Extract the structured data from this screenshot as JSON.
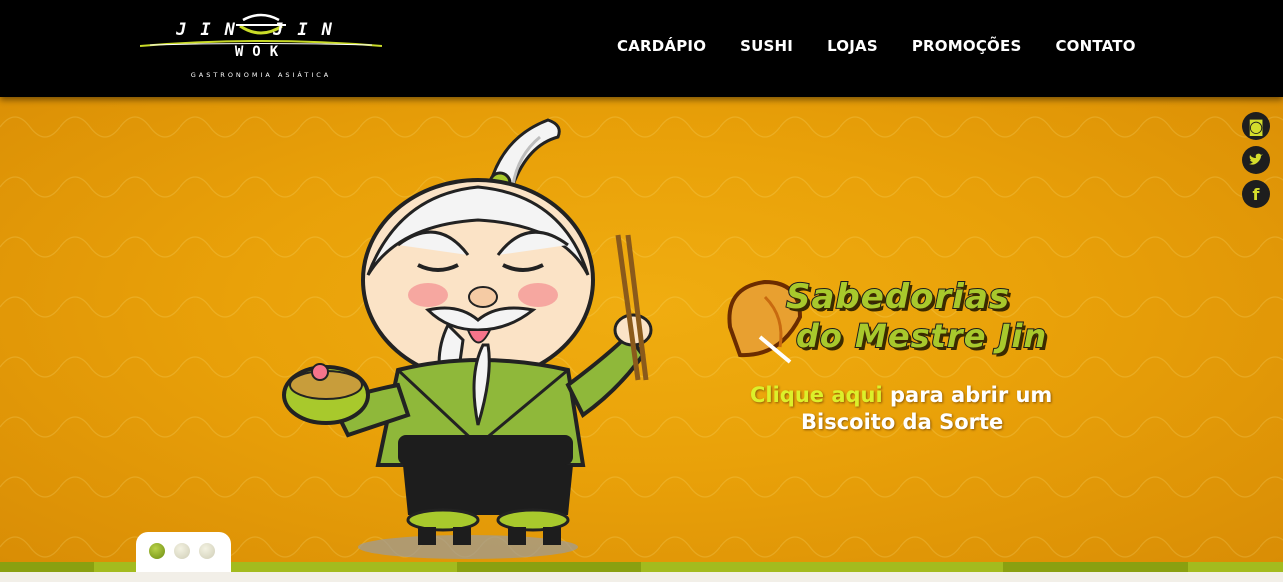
{
  "header": {
    "logo": {
      "brand": "JIN JIN",
      "sub": "WOK",
      "tagline": "GASTRONOMIA ASIÁTICA"
    },
    "nav": [
      {
        "label": "CARDÁPIO"
      },
      {
        "label": "SUSHI"
      },
      {
        "label": "LOJAS"
      },
      {
        "label": "PROMOÇÕES"
      },
      {
        "label": "CONTATO"
      }
    ]
  },
  "banner": {
    "title_line1": "Sabedorias",
    "title_line2": "do Mestre Jin",
    "cta_highlight": "Clique aqui",
    "cta_rest": " para abrir um",
    "cta_line2": "Biscoito da Sorte"
  },
  "social": [
    {
      "icon": "instagram-icon",
      "glyph": "◙"
    },
    {
      "icon": "twitter-icon",
      "glyph": "🐦"
    },
    {
      "icon": "facebook-icon",
      "glyph": "f"
    }
  ],
  "slider": {
    "slides": 3,
    "active": 1
  },
  "colors": {
    "header_bg": "#000000",
    "banner_bg": "#e9a20a",
    "accent_green": "#a8c92c",
    "cta_highlight": "#dcf02a",
    "social_bg": "#1e1e1e"
  }
}
